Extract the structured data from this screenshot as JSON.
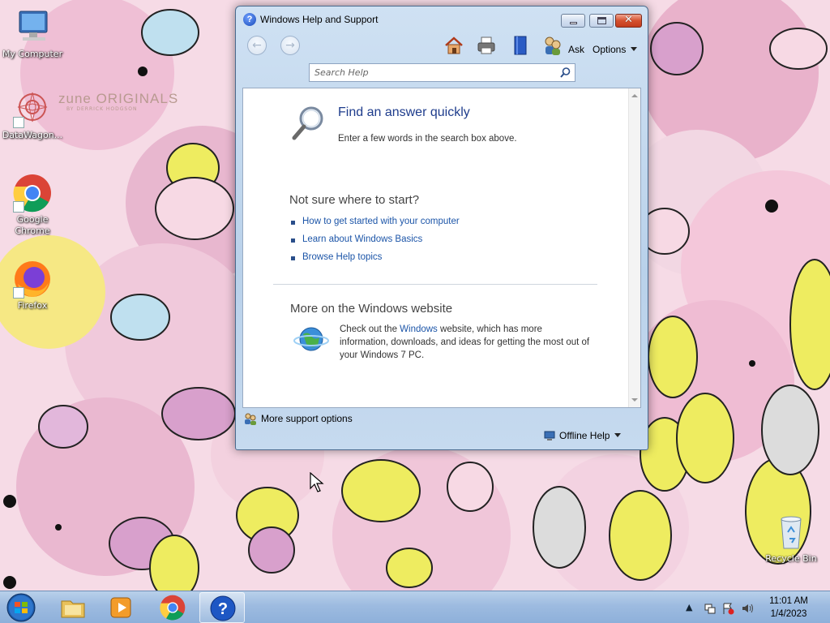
{
  "desktop": {
    "icons": [
      {
        "label": "My Computer"
      },
      {
        "label": "DataWagon..."
      },
      {
        "label": "Google Chrome"
      },
      {
        "label": "Firefox"
      },
      {
        "label": "Recycle Bin"
      }
    ],
    "wallpaper_logo": {
      "brand": "zune ORIGINALS",
      "credit": "BY DERRICK HODGSON"
    }
  },
  "help_window": {
    "title": "Windows Help and Support",
    "toolbar": {
      "icons": [
        "back-arrow-icon",
        "forward-arrow-icon",
        "home-icon",
        "print-icon",
        "browse-help-icon",
        "ask-icon"
      ],
      "ask_label": "Ask",
      "options_label": "Options"
    },
    "search": {
      "placeholder": "Search Help",
      "value": ""
    },
    "content": {
      "find_title": "Find an answer quickly",
      "find_sub": "Enter a few words in the search box above.",
      "start_heading": "Not sure where to start?",
      "links": [
        "How to get started with your computer",
        "Learn about Windows Basics",
        "Browse Help topics"
      ],
      "web_heading": "More on the Windows website",
      "web_text_before": "Check out the ",
      "web_link": "Windows",
      "web_text_after": " website, which has more information, downloads, and ideas for getting the most out of your Windows 7 PC."
    },
    "footer": {
      "more_support": "More support options",
      "offline_help": "Offline Help"
    }
  },
  "taskbar": {
    "apps": [
      "start-orb",
      "windows-explorer",
      "windows-media-player",
      "google-chrome",
      "windows-help-and-support"
    ],
    "active_app": "windows-help-and-support",
    "clock": {
      "time": "11:01 AM",
      "date": "1/4/2023"
    }
  },
  "colors": {
    "wallpaper_bg": "#f6dbe6",
    "link": "#1c55a8",
    "heading_blue": "#1e3c8c",
    "close_button": "#d5512f",
    "taskbar": "#9dbbe0"
  }
}
